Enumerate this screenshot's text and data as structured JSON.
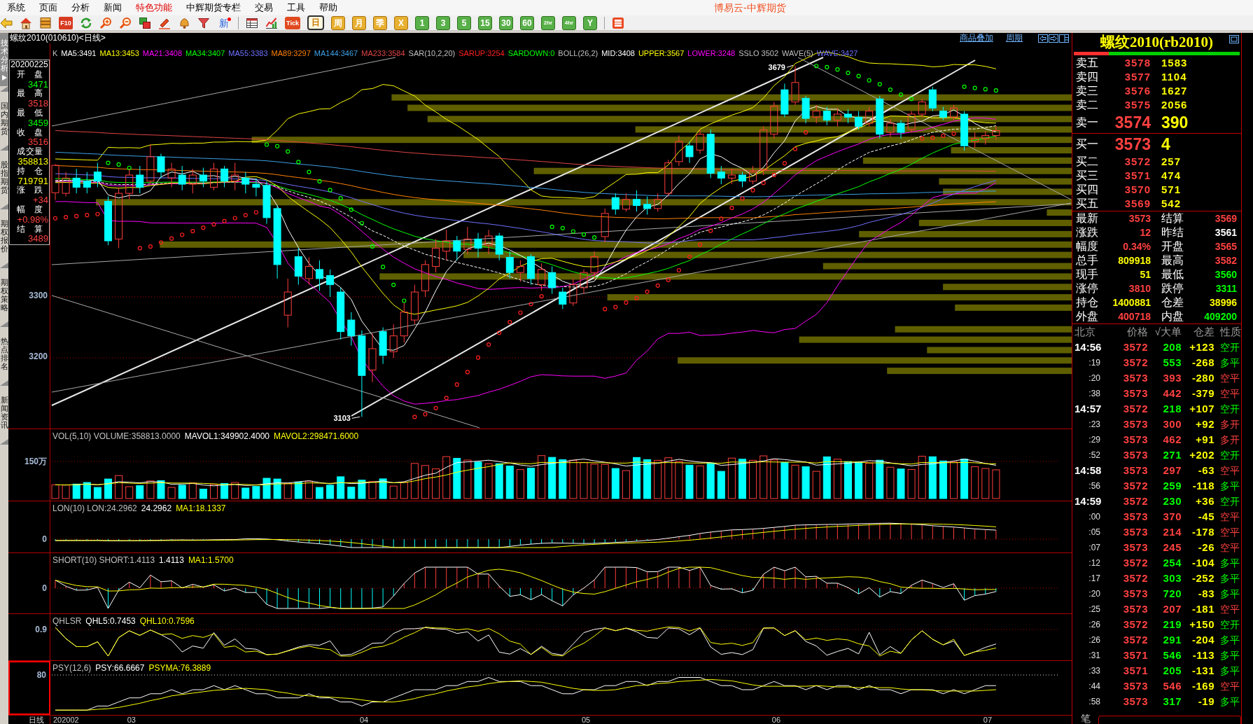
{
  "menu": {
    "items": [
      {
        "label": "系统",
        "highlight": false
      },
      {
        "label": "页面",
        "highlight": false
      },
      {
        "label": "分析",
        "highlight": false
      },
      {
        "label": "新闻",
        "highlight": false
      },
      {
        "label": "特色功能",
        "highlight": true
      },
      {
        "label": "中辉期货专栏",
        "highlight": false
      },
      {
        "label": "交易",
        "highlight": false
      },
      {
        "label": "工具",
        "highlight": false
      },
      {
        "label": "帮助",
        "highlight": false
      }
    ],
    "app_title": "博易云-中辉期货"
  },
  "toolbar": {
    "f10_label": "F10",
    "news_label": "新",
    "tick_label": "Tick",
    "periods": [
      {
        "label": "日",
        "kind": "calendar",
        "selected": true
      },
      {
        "label": "周",
        "kind": "calendar",
        "selected": false
      },
      {
        "label": "月",
        "kind": "calendar",
        "selected": false
      },
      {
        "label": "季",
        "kind": "calendar",
        "selected": false
      },
      {
        "label": "X",
        "kind": "calendar",
        "selected": false
      },
      {
        "label": "1",
        "kind": "minute",
        "selected": false
      },
      {
        "label": "3",
        "kind": "minute",
        "selected": false
      },
      {
        "label": "5",
        "kind": "minute",
        "selected": false
      },
      {
        "label": "15",
        "kind": "minute",
        "selected": false
      },
      {
        "label": "30",
        "kind": "minute",
        "selected": false
      },
      {
        "label": "60",
        "kind": "minute",
        "selected": false
      },
      {
        "label": "2hr",
        "kind": "minute",
        "selected": false
      },
      {
        "label": "4hr",
        "kind": "minute",
        "selected": false
      },
      {
        "label": "Y",
        "kind": "minute",
        "selected": false
      }
    ]
  },
  "sidebar": {
    "tabs": [
      {
        "label": "技术分析",
        "selected": true
      },
      {
        "label": "国内期货",
        "selected": false
      },
      {
        "label": "股指期货",
        "selected": false
      },
      {
        "label": "期权报价",
        "selected": false
      },
      {
        "label": "期权策略",
        "selected": false
      },
      {
        "label": "热点排名",
        "selected": false
      },
      {
        "label": "新闻资讯",
        "selected": false
      }
    ]
  },
  "chart_header": {
    "title": "螺纹2010(010610)<日线>",
    "links": [
      "商品叠加",
      "周期"
    ]
  },
  "main_chart": {
    "legend": [
      {
        "text": "K",
        "color": "#c0c0c0"
      },
      {
        "text": "MA5:3491",
        "color": "#ffffff"
      },
      {
        "text": "MA13:3453",
        "color": "#ffff00"
      },
      {
        "text": "MA21:3408",
        "color": "#ff00ff"
      },
      {
        "text": "MA34:3407",
        "color": "#00ff00"
      },
      {
        "text": "MA55:3383",
        "color": "#7070ff"
      },
      {
        "text": "MA89:3297",
        "color": "#ff8000"
      },
      {
        "text": "MA144:3467",
        "color": "#3ca0e6"
      },
      {
        "text": "MA233:3584",
        "color": "#e04444"
      },
      {
        "text": "SAR(10,2,20)",
        "color": "#c0c0c0"
      },
      {
        "text": "SARUP:3254",
        "color": "#ff2020"
      },
      {
        "text": "SARDOWN:0",
        "color": "#00ff00"
      },
      {
        "text": "BOLL(26,2)",
        "color": "#c0c0c0"
      },
      {
        "text": "MID:3408",
        "color": "#ffffff"
      },
      {
        "text": "UPPER:3567",
        "color": "#ffff00"
      },
      {
        "text": "LOWER:3248",
        "color": "#ff00ff"
      },
      {
        "text": "SSLO 3502",
        "color": "#c0c0c0"
      },
      {
        "text": "WAVE(5)",
        "color": "#c0c0c0"
      },
      {
        "text": "WAVE:3427",
        "color": "#7070ff"
      }
    ],
    "info_box": {
      "date": "20200225",
      "fields": [
        {
          "label": "开盘",
          "value": "3471",
          "color": "#00ff00"
        },
        {
          "label": "最高",
          "value": "3518",
          "color": "#ff4040"
        },
        {
          "label": "最低",
          "value": "3459",
          "color": "#00ff00"
        },
        {
          "label": "收盘",
          "value": "3516",
          "color": "#ff4040"
        },
        {
          "label": "成交量",
          "value": "358813",
          "color": "#ffff00"
        },
        {
          "label": "持仓",
          "value": "719791",
          "color": "#ffff00"
        },
        {
          "label": "涨跌",
          "value": "+34",
          "color": "#ff4040"
        },
        {
          "label": "幅度",
          "value": "+0.98%",
          "color": "#ff4040"
        },
        {
          "label": "结算",
          "value": "3489",
          "color": "#ff4040"
        }
      ]
    },
    "y_ticks": [
      "3300",
      "3200"
    ],
    "high_label": "3679",
    "low_label": "3103"
  },
  "indicator_panels": [
    {
      "kind": "volume",
      "selected": false,
      "tick": "150万",
      "legend": [
        {
          "text": "VOL(5,10) VOLUME:358813.0000",
          "color": "#c0c0c0"
        },
        {
          "text": "MAVOL1:349902.4000",
          "color": "#ffffff"
        },
        {
          "text": "MAVOL2:298471.6000",
          "color": "#ffff00"
        }
      ]
    },
    {
      "kind": "lon",
      "selected": false,
      "tick": "0",
      "legend": [
        {
          "text": "LON(10) LON:24.2962",
          "color": "#c0c0c0"
        },
        {
          "text": "24.2962",
          "color": "#ffffff"
        },
        {
          "text": "MA1:18.1337",
          "color": "#ffff00"
        }
      ]
    },
    {
      "kind": "short",
      "selected": false,
      "tick": "0",
      "legend": [
        {
          "text": "SHORT(10) SHORT:1.4113",
          "color": "#c0c0c0"
        },
        {
          "text": "1.4113",
          "color": "#ffffff"
        },
        {
          "text": "MA1:1.5700",
          "color": "#ffff00"
        }
      ]
    },
    {
      "kind": "qhlsr",
      "selected": false,
      "tick": "0.9",
      "legend": [
        {
          "text": "QHLSR",
          "color": "#c0c0c0"
        },
        {
          "text": "QHL5:0.7453",
          "color": "#ffffff"
        },
        {
          "text": "QHL10:0.7596",
          "color": "#ffff00"
        }
      ]
    },
    {
      "kind": "psy",
      "selected": true,
      "tick": "80",
      "legend": [
        {
          "text": "PSY(12,6)",
          "color": "#c0c0c0"
        },
        {
          "text": "PSY:66.6667",
          "color": "#ffffff"
        },
        {
          "text": "PSYMA:76.3889",
          "color": "#ffff00"
        }
      ]
    }
  ],
  "date_axis": {
    "label": "日线",
    "ticks": [
      "202002",
      "03",
      "04",
      "05",
      "06",
      "07"
    ]
  },
  "quote_panel": {
    "title": "螺纹2010(rb2010)",
    "ratio_bar": {
      "level": 0.21
    },
    "asks": [
      {
        "label": "卖五",
        "price": "3578",
        "volume": "1583",
        "kind": "depth"
      },
      {
        "label": "卖四",
        "price": "3577",
        "volume": "1104",
        "kind": "depth"
      },
      {
        "label": "卖三",
        "price": "3576",
        "volume": "1627",
        "kind": "depth"
      },
      {
        "label": "卖二",
        "price": "3575",
        "volume": "2056",
        "kind": "depth"
      },
      {
        "label": "卖一",
        "price": "3574",
        "volume": "390",
        "kind": "best"
      }
    ],
    "bids": [
      {
        "label": "买一",
        "price": "3573",
        "volume": "4",
        "kind": "best"
      },
      {
        "label": "买二",
        "price": "3572",
        "volume": "257",
        "kind": "depth"
      },
      {
        "label": "买三",
        "price": "3571",
        "volume": "474",
        "kind": "depth"
      },
      {
        "label": "买四",
        "price": "3570",
        "volume": "571",
        "kind": "depth"
      },
      {
        "label": "买五",
        "price": "3569",
        "volume": "542",
        "kind": "depth"
      }
    ],
    "stats": [
      {
        "label": "最新",
        "value": "3573",
        "color": "#ff4040"
      },
      {
        "label": "结算",
        "value": "3569",
        "color": "#ff4040"
      },
      {
        "label": "涨跌",
        "value": "12",
        "color": "#ff4040"
      },
      {
        "label": "昨结",
        "value": "3561",
        "color": "#ffffff"
      },
      {
        "label": "幅度",
        "value": "0.34%",
        "color": "#ff4040"
      },
      {
        "label": "开盘",
        "value": "3565",
        "color": "#ff4040"
      },
      {
        "label": "总手",
        "value": "809918",
        "color": "#ffff00"
      },
      {
        "label": "最高",
        "value": "3582",
        "color": "#ff4040"
      },
      {
        "label": "现手",
        "value": "51",
        "color": "#ffff00"
      },
      {
        "label": "最低",
        "value": "3560",
        "color": "#00ff00"
      },
      {
        "label": "涨停",
        "value": "3810",
        "color": "#ff4040"
      },
      {
        "label": "跌停",
        "value": "3311",
        "color": "#00ff00"
      },
      {
        "label": "持仓",
        "value": "1400881",
        "color": "#ffff00"
      },
      {
        "label": "仓差",
        "value": "38996",
        "color": "#ffff00"
      },
      {
        "label": "外盘",
        "value": "400718",
        "color": "#ff4040"
      },
      {
        "label": "内盘",
        "value": "409200",
        "color": "#00ff00"
      }
    ],
    "trades_header": [
      "北京",
      "价格",
      "√大单",
      "仓差",
      "性质"
    ],
    "trades": [
      {
        "time": "14:56",
        "kind": "minute",
        "price": "3572",
        "volume": "208",
        "change": "+123",
        "nature": "空开",
        "color": "#00ff00"
      },
      {
        "time": ":19",
        "kind": "second",
        "price": "3572",
        "volume": "553",
        "change": "-268",
        "nature": "多平",
        "color": "#00ff00"
      },
      {
        "time": ":20",
        "kind": "second",
        "price": "3573",
        "volume": "393",
        "change": "-280",
        "nature": "空平",
        "color": "#ff4040"
      },
      {
        "time": ":38",
        "kind": "second",
        "price": "3573",
        "volume": "442",
        "change": "-379",
        "nature": "空平",
        "color": "#ff4040"
      },
      {
        "time": "14:57",
        "kind": "minute",
        "price": "3572",
        "volume": "218",
        "change": "+107",
        "nature": "空开",
        "color": "#00ff00"
      },
      {
        "time": ":23",
        "kind": "second",
        "price": "3573",
        "volume": "300",
        "change": "+92",
        "nature": "多开",
        "color": "#ff4040"
      },
      {
        "time": ":29",
        "kind": "second",
        "price": "3573",
        "volume": "462",
        "change": "+91",
        "nature": "多开",
        "color": "#ff4040"
      },
      {
        "time": ":52",
        "kind": "second",
        "price": "3573",
        "volume": "271",
        "change": "+202",
        "nature": "空开",
        "color": "#00ff00"
      },
      {
        "time": "14:58",
        "kind": "minute",
        "price": "3573",
        "volume": "297",
        "change": "-63",
        "nature": "空平",
        "color": "#ff4040"
      },
      {
        "time": ":56",
        "kind": "second",
        "price": "3572",
        "volume": "259",
        "change": "-118",
        "nature": "多平",
        "color": "#00ff00"
      },
      {
        "time": "14:59",
        "kind": "minute",
        "price": "3572",
        "volume": "230",
        "change": "+36",
        "nature": "空开",
        "color": "#00ff00"
      },
      {
        "time": ":00",
        "kind": "second",
        "price": "3573",
        "volume": "370",
        "change": "-45",
        "nature": "空平",
        "color": "#ff4040"
      },
      {
        "time": ":05",
        "kind": "second",
        "price": "3573",
        "volume": "214",
        "change": "-178",
        "nature": "空平",
        "color": "#ff4040"
      },
      {
        "time": ":07",
        "kind": "second",
        "price": "3573",
        "volume": "245",
        "change": "-26",
        "nature": "空平",
        "color": "#ff4040"
      },
      {
        "time": ":12",
        "kind": "second",
        "price": "3572",
        "volume": "254",
        "change": "-104",
        "nature": "多平",
        "color": "#00ff00"
      },
      {
        "time": ":17",
        "kind": "second",
        "price": "3572",
        "volume": "303",
        "change": "-252",
        "nature": "多平",
        "color": "#00ff00"
      },
      {
        "time": ":20",
        "kind": "second",
        "price": "3573",
        "volume": "720",
        "change": "-83",
        "nature": "多平",
        "color": "#00ff00"
      },
      {
        "time": ":25",
        "kind": "second",
        "price": "3573",
        "volume": "207",
        "change": "-181",
        "nature": "空平",
        "color": "#ff4040"
      },
      {
        "time": ":26",
        "kind": "second",
        "price": "3572",
        "volume": "219",
        "change": "+150",
        "nature": "空开",
        "color": "#00ff00"
      },
      {
        "time": ":26",
        "kind": "second",
        "price": "3572",
        "volume": "291",
        "change": "-204",
        "nature": "多平",
        "color": "#00ff00"
      },
      {
        "time": ":31",
        "kind": "second",
        "price": "3571",
        "volume": "546",
        "change": "-113",
        "nature": "多平",
        "color": "#00ff00"
      },
      {
        "time": ":33",
        "kind": "second",
        "price": "3571",
        "volume": "205",
        "change": "-131",
        "nature": "多平",
        "color": "#00ff00"
      },
      {
        "time": ":44",
        "kind": "second",
        "price": "3573",
        "volume": "546",
        "change": "-169",
        "nature": "空平",
        "color": "#ff4040"
      },
      {
        "time": ":58",
        "kind": "second",
        "price": "3573",
        "volume": "317",
        "change": "-19",
        "nature": "多平",
        "color": "#00ff00"
      }
    ],
    "footer_label": "笔"
  }
}
